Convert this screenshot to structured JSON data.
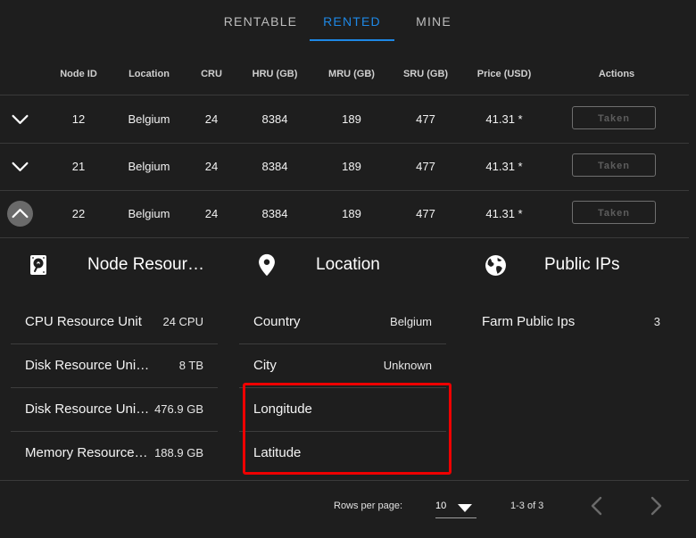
{
  "tabs": [
    {
      "label": "RENTABLE"
    },
    {
      "label": "RENTED"
    },
    {
      "label": "MINE"
    }
  ],
  "active_tab": "RENTED",
  "table": {
    "columns": [
      "Node ID",
      "Location",
      "CRU",
      "HRU (GB)",
      "MRU (GB)",
      "SRU (GB)",
      "Price (USD)",
      "Actions"
    ],
    "rows": [
      {
        "node_id": "12",
        "location": "Belgium",
        "cru": "24",
        "hru": "8384",
        "mru": "189",
        "sru": "477",
        "price": "41.31 *",
        "action": "Taken",
        "expanded": false
      },
      {
        "node_id": "21",
        "location": "Belgium",
        "cru": "24",
        "hru": "8384",
        "mru": "189",
        "sru": "477",
        "price": "41.31 *",
        "action": "Taken",
        "expanded": false
      },
      {
        "node_id": "22",
        "location": "Belgium",
        "cru": "24",
        "hru": "8384",
        "mru": "189",
        "sru": "477",
        "price": "41.31 *",
        "action": "Taken",
        "expanded": true
      }
    ]
  },
  "details": {
    "resources": {
      "title": "Node Resour…",
      "items": [
        {
          "label": "CPU Resource Unit",
          "value": "24 CPU"
        },
        {
          "label": "Disk Resource Unit (H…",
          "value": "8 TB"
        },
        {
          "label": "Disk Resource Uni…",
          "value": "476.9 GB"
        },
        {
          "label": "Memory Resource…",
          "value": "188.9 GB"
        }
      ]
    },
    "location": {
      "title": "Location",
      "items": [
        {
          "label": "Country",
          "value": "Belgium"
        },
        {
          "label": "City",
          "value": "Unknown"
        },
        {
          "label": "Longitude",
          "value": ""
        },
        {
          "label": "Latitude",
          "value": ""
        }
      ]
    },
    "public_ips": {
      "title": "Public IPs",
      "items": [
        {
          "label": "Farm Public Ips",
          "value": "3"
        }
      ]
    }
  },
  "footer": {
    "rows_per_page_label": "Rows per page:",
    "rows_per_page_value": "10",
    "page_info": "1-3 of 3"
  },
  "colors": {
    "background": "#1e1e1e",
    "accent": "#1e88e5",
    "highlight": "#ee0000"
  }
}
